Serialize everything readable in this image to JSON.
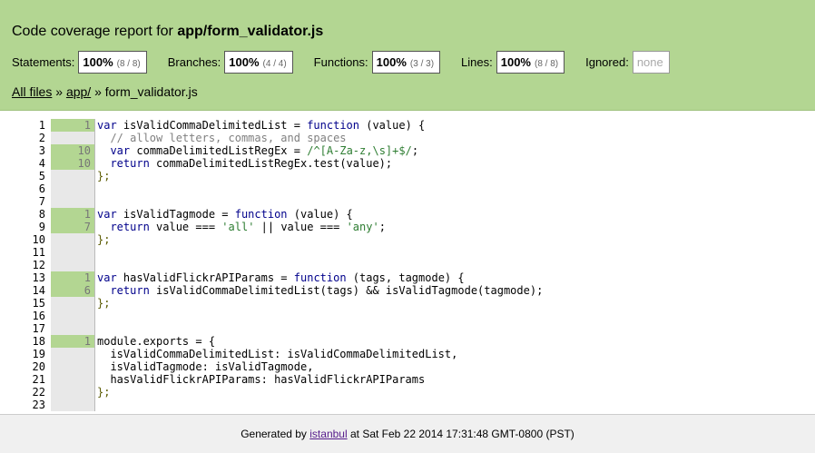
{
  "header": {
    "title_prefix": "Code coverage report for ",
    "title_file": "app/form_validator.js",
    "metrics": [
      {
        "label": "Statements:",
        "pct": "100%",
        "frac": "(8 / 8)"
      },
      {
        "label": "Branches:",
        "pct": "100%",
        "frac": "(4 / 4)"
      },
      {
        "label": "Functions:",
        "pct": "100%",
        "frac": "(3 / 3)"
      },
      {
        "label": "Lines:",
        "pct": "100%",
        "frac": "(8 / 8)"
      }
    ],
    "ignored_label": "Ignored:",
    "ignored_value": "none",
    "breadcrumb": {
      "all_files": "All files",
      "sep1": " » ",
      "dir": "app/",
      "sep2": " » ",
      "file": "form_validator.js"
    }
  },
  "lines": [
    {
      "n": "1",
      "count": "1",
      "hit": true,
      "code": "var isValidCommaDelimitedList = function (value) {"
    },
    {
      "n": "2",
      "count": "",
      "hit": false,
      "code": "  // allow letters, commas, and spaces"
    },
    {
      "n": "3",
      "count": "10",
      "hit": true,
      "code": "  var commaDelimitedListRegEx = /^[A-Za-z,\\s]+$/;"
    },
    {
      "n": "4",
      "count": "10",
      "hit": true,
      "code": "  return commaDelimitedListRegEx.test(value);"
    },
    {
      "n": "5",
      "count": "",
      "hit": false,
      "code": "};"
    },
    {
      "n": "6",
      "count": "",
      "hit": false,
      "code": ""
    },
    {
      "n": "7",
      "count": "",
      "hit": false,
      "code": ""
    },
    {
      "n": "8",
      "count": "1",
      "hit": true,
      "code": "var isValidTagmode = function (value) {"
    },
    {
      "n": "9",
      "count": "7",
      "hit": true,
      "code": "  return value === 'all' || value === 'any';"
    },
    {
      "n": "10",
      "count": "",
      "hit": false,
      "code": "};"
    },
    {
      "n": "11",
      "count": "",
      "hit": false,
      "code": ""
    },
    {
      "n": "12",
      "count": "",
      "hit": false,
      "code": ""
    },
    {
      "n": "13",
      "count": "1",
      "hit": true,
      "code": "var hasValidFlickrAPIParams = function (tags, tagmode) {"
    },
    {
      "n": "14",
      "count": "6",
      "hit": true,
      "code": "  return isValidCommaDelimitedList(tags) && isValidTagmode(tagmode);"
    },
    {
      "n": "15",
      "count": "",
      "hit": false,
      "code": "};"
    },
    {
      "n": "16",
      "count": "",
      "hit": false,
      "code": ""
    },
    {
      "n": "17",
      "count": "",
      "hit": false,
      "code": ""
    },
    {
      "n": "18",
      "count": "1",
      "hit": true,
      "code": "module.exports = {"
    },
    {
      "n": "19",
      "count": "",
      "hit": false,
      "code": "  isValidCommaDelimitedList: isValidCommaDelimitedList,"
    },
    {
      "n": "20",
      "count": "",
      "hit": false,
      "code": "  isValidTagmode: isValidTagmode,"
    },
    {
      "n": "21",
      "count": "",
      "hit": false,
      "code": "  hasValidFlickrAPIParams: hasValidFlickrAPIParams"
    },
    {
      "n": "22",
      "count": "",
      "hit": false,
      "code": "};"
    },
    {
      "n": "23",
      "count": "",
      "hit": false,
      "code": ""
    }
  ],
  "footer": {
    "prefix": "Generated by ",
    "link": "istanbul",
    "suffix": " at Sat Feb 22 2014 17:31:48 GMT-0800 (PST)"
  },
  "colors": {
    "header_bg": "#b3d692",
    "hit_bg": "#b3d692",
    "gutter_bg": "#e8e8e8",
    "footer_bg": "#f0f0f0"
  }
}
